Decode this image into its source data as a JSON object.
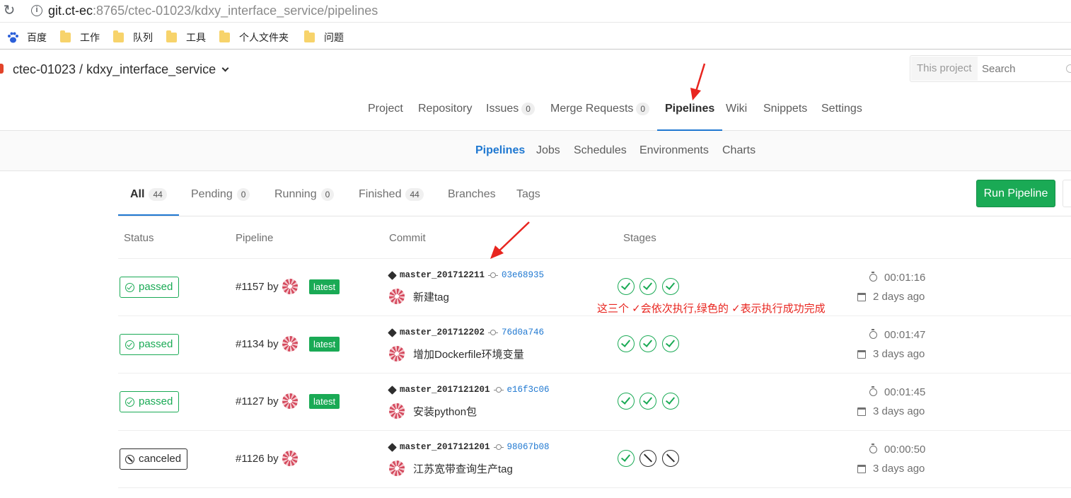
{
  "browser": {
    "url_host": "git.ct-ec",
    "url_rest": ":8765/ctec-01023/kdxy_interface_service/pipelines",
    "bookmarks": [
      "百度",
      "工作",
      "队列",
      "工具",
      "个人文件夹",
      "问题"
    ]
  },
  "header": {
    "project_path": "ctec-01023 / kdxy_interface_service",
    "search_scope": "This project",
    "search_placeholder": "Search"
  },
  "main_nav": [
    {
      "label": "Project"
    },
    {
      "label": "Repository"
    },
    {
      "label": "Issues",
      "count": "0"
    },
    {
      "label": "Merge Requests",
      "count": "0"
    },
    {
      "label": "Pipelines",
      "active": true
    },
    {
      "label": "Wiki"
    },
    {
      "label": "Snippets"
    },
    {
      "label": "Settings"
    }
  ],
  "sub_nav": [
    {
      "label": "Pipelines",
      "active": true
    },
    {
      "label": "Jobs"
    },
    {
      "label": "Schedules"
    },
    {
      "label": "Environments"
    },
    {
      "label": "Charts"
    }
  ],
  "scope_tabs": [
    {
      "label": "All",
      "count": "44",
      "active": true
    },
    {
      "label": "Pending",
      "count": "0"
    },
    {
      "label": "Running",
      "count": "0"
    },
    {
      "label": "Finished",
      "count": "44"
    },
    {
      "label": "Branches"
    },
    {
      "label": "Tags"
    }
  ],
  "run_pipeline_label": "Run Pipeline",
  "table": {
    "headers": [
      "Status",
      "Pipeline",
      "Commit",
      "Stages"
    ],
    "rows": [
      {
        "status": "passed",
        "pipeline": "#1157 by",
        "latest": "latest",
        "ref": "master_201712211",
        "sha": "03e68935",
        "title": "新建tag",
        "stages": [
          "success",
          "success",
          "success"
        ],
        "duration": "00:01:16",
        "finished": "2 days ago"
      },
      {
        "status": "passed",
        "pipeline": "#1134 by",
        "latest": "latest",
        "ref": "master_201712202",
        "sha": "76d0a746",
        "title": "增加Dockerfile环境变量",
        "stages": [
          "success",
          "success",
          "success"
        ],
        "duration": "00:01:47",
        "finished": "3 days ago"
      },
      {
        "status": "passed",
        "pipeline": "#1127 by",
        "latest": "latest",
        "ref": "master_2017121201",
        "sha": "e16f3c06",
        "title": "安装python包",
        "stages": [
          "success",
          "success",
          "success"
        ],
        "duration": "00:01:45",
        "finished": "3 days ago"
      },
      {
        "status": "canceled",
        "pipeline": "#1126 by",
        "latest": "",
        "ref": "master_2017121201",
        "sha": "98067b08",
        "title": "江苏宽带查询生产tag",
        "stages": [
          "success",
          "canceled",
          "canceled"
        ],
        "duration": "00:00:50",
        "finished": "3 days ago"
      }
    ]
  },
  "annotation": "这三个 ✓会依次执行,绿色的 ✓表示执行成功完成",
  "colors": {
    "accent": "#1f78d1",
    "success": "#1aaa55",
    "annotation": "#e8251f"
  }
}
